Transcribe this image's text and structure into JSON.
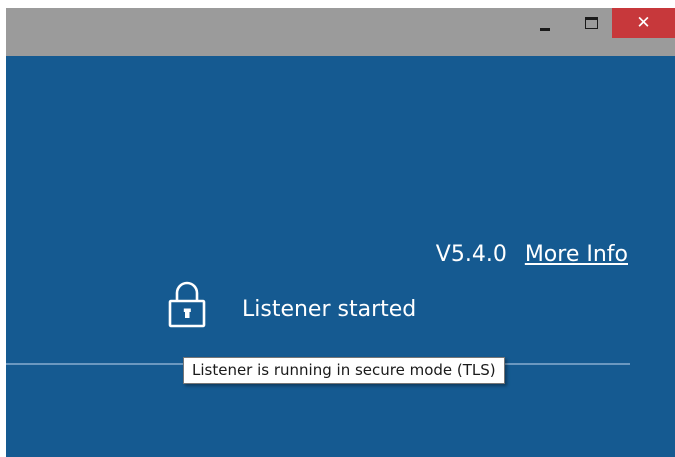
{
  "window": {
    "title_buttons": {
      "minimize_icon": "minimize-icon",
      "maximize_icon": "maximize-icon",
      "close_icon": "close-icon",
      "close_glyph": "✕",
      "close_color": "#c7383b"
    },
    "background_color": "#155a91",
    "titlebar_color": "#9b9b9b"
  },
  "main": {
    "version": "V5.4.0",
    "more_info_label": "More Info",
    "status_icon": "lock-icon",
    "status_text": "Listener started"
  },
  "tooltip": {
    "text": "Listener is running in secure mode (TLS)"
  }
}
